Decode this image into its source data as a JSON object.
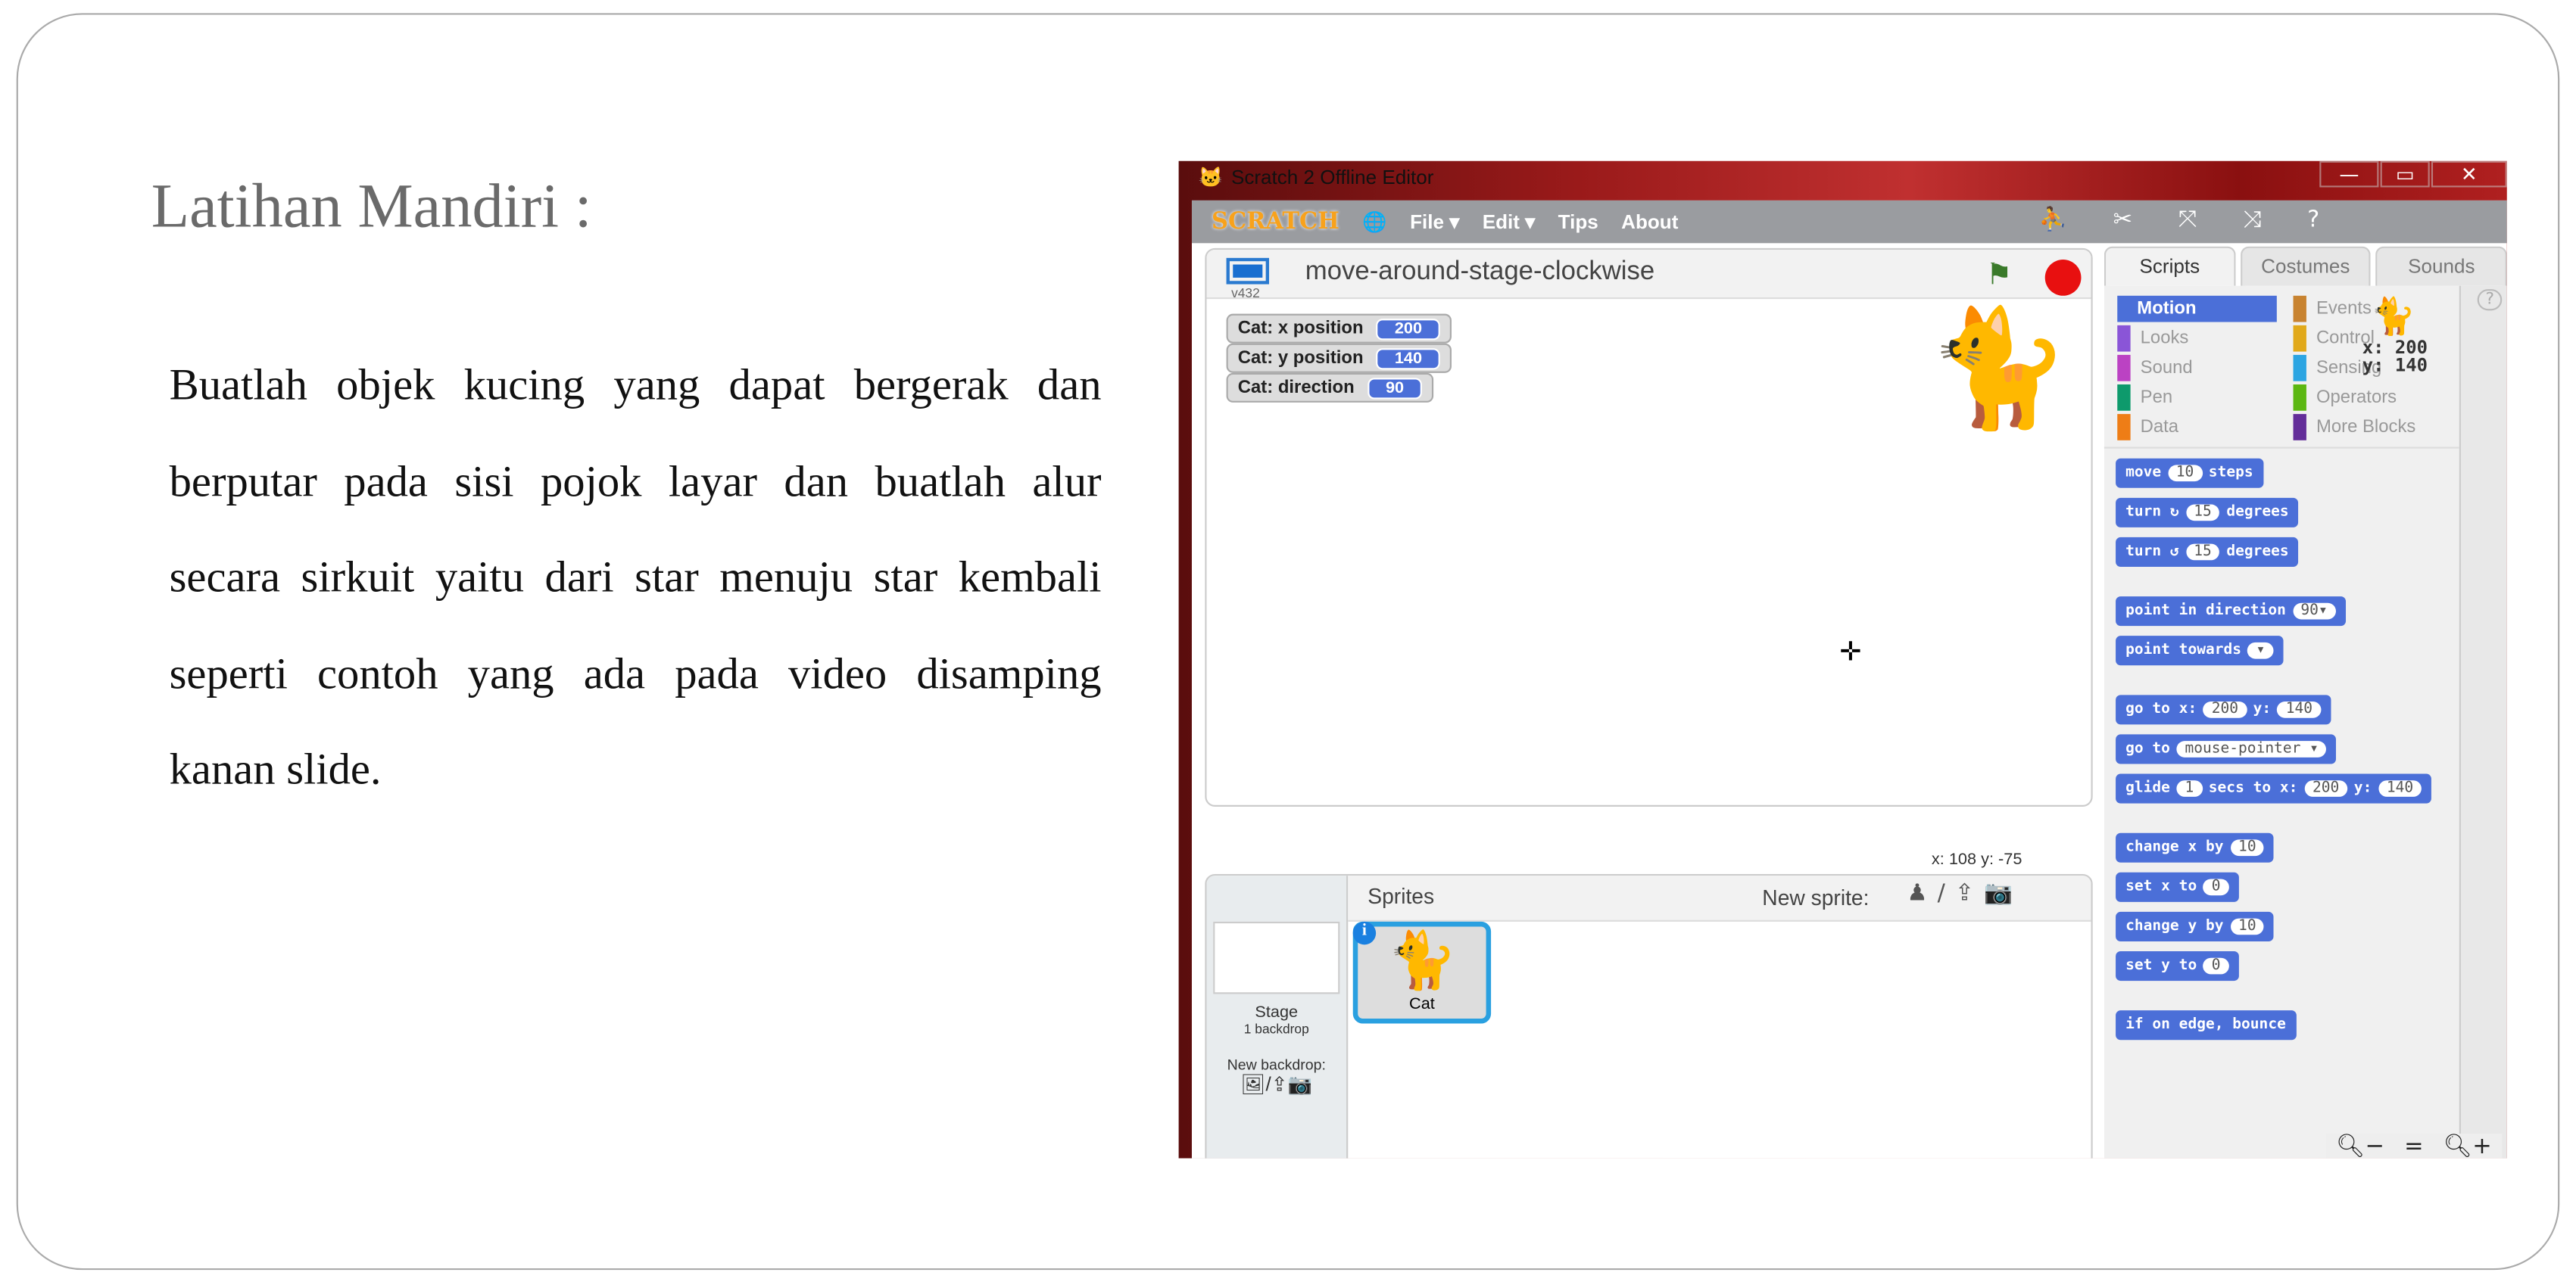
{
  "slide": {
    "title": "Latihan Mandiri :",
    "paragraph": "Buatlah objek kucing yang dapat bergerak dan berputar pada sisi pojok layar dan buatlah alur secara sirkuit yaitu dari star menuju star kembali seperti contoh yang ada pada video disamping kanan slide."
  },
  "window": {
    "title": "Scratch 2 Offline Editor",
    "minimize": "—",
    "maximize": "▭",
    "close": "✕"
  },
  "menu": {
    "logo": "SCRATCH",
    "items": [
      "File ▾",
      "Edit ▾",
      "Tips",
      "About"
    ]
  },
  "stage": {
    "project_name": "move-around-stage-clockwise",
    "version": "v432",
    "monitors": [
      {
        "label": "Cat: x position",
        "value": "200"
      },
      {
        "label": "Cat: y position",
        "value": "140"
      },
      {
        "label": "Cat: direction",
        "value": "90"
      }
    ],
    "mouse_coords": "x: 108  y: -75"
  },
  "sprites": {
    "header": "Sprites",
    "new_sprite": "New sprite:",
    "stage_label": "Stage",
    "stage_sub": "1 backdrop",
    "new_backdrop": "New backdrop:",
    "items": [
      {
        "name": "Cat"
      }
    ]
  },
  "tabs": [
    "Scripts",
    "Costumes",
    "Sounds"
  ],
  "categories": [
    {
      "name": "Motion",
      "color": "#4a6cd4"
    },
    {
      "name": "Events",
      "color": "#c88330"
    },
    {
      "name": "Looks",
      "color": "#8a55d7"
    },
    {
      "name": "Control",
      "color": "#e1a91a"
    },
    {
      "name": "Sound",
      "color": "#bb42c3"
    },
    {
      "name": "Sensing",
      "color": "#2ca5e2"
    },
    {
      "name": "Pen",
      "color": "#0e9a6c"
    },
    {
      "name": "Operators",
      "color": "#5cb712"
    },
    {
      "name": "Data",
      "color": "#ee7d16"
    },
    {
      "name": "More Blocks",
      "color": "#632d99"
    }
  ],
  "sprite_info": {
    "x": "x: 200",
    "y": "y: 140"
  },
  "blocks": [
    [
      [
        "t",
        "move"
      ],
      [
        "v",
        "10"
      ],
      [
        "t",
        "steps"
      ]
    ],
    [
      [
        "t",
        "turn ↻"
      ],
      [
        "v",
        "15"
      ],
      [
        "t",
        "degrees"
      ]
    ],
    [
      [
        "t",
        "turn ↺"
      ],
      [
        "v",
        "15"
      ],
      [
        "t",
        "degrees"
      ]
    ],
    null,
    [
      [
        "t",
        "point in direction"
      ],
      [
        "v",
        "90▾"
      ]
    ],
    [
      [
        "t",
        "point towards"
      ],
      [
        "v",
        "  ▾"
      ]
    ],
    null,
    [
      [
        "t",
        "go to x:"
      ],
      [
        "v",
        "200"
      ],
      [
        "t",
        "y:"
      ],
      [
        "v",
        "140"
      ]
    ],
    [
      [
        "t",
        "go to"
      ],
      [
        "v",
        "mouse-pointer ▾"
      ]
    ],
    [
      [
        "t",
        "glide"
      ],
      [
        "v",
        "1"
      ],
      [
        "t",
        "secs to x:"
      ],
      [
        "v",
        "200"
      ],
      [
        "t",
        "y:"
      ],
      [
        "v",
        "140"
      ]
    ],
    null,
    [
      [
        "t",
        "change x by"
      ],
      [
        "v",
        "10"
      ]
    ],
    [
      [
        "t",
        "set x to"
      ],
      [
        "v",
        "0"
      ]
    ],
    [
      [
        "t",
        "change y by"
      ],
      [
        "v",
        "10"
      ]
    ],
    [
      [
        "t",
        "set y to"
      ],
      [
        "v",
        "0"
      ]
    ],
    null,
    [
      [
        "t",
        "if on edge, bounce"
      ]
    ]
  ]
}
